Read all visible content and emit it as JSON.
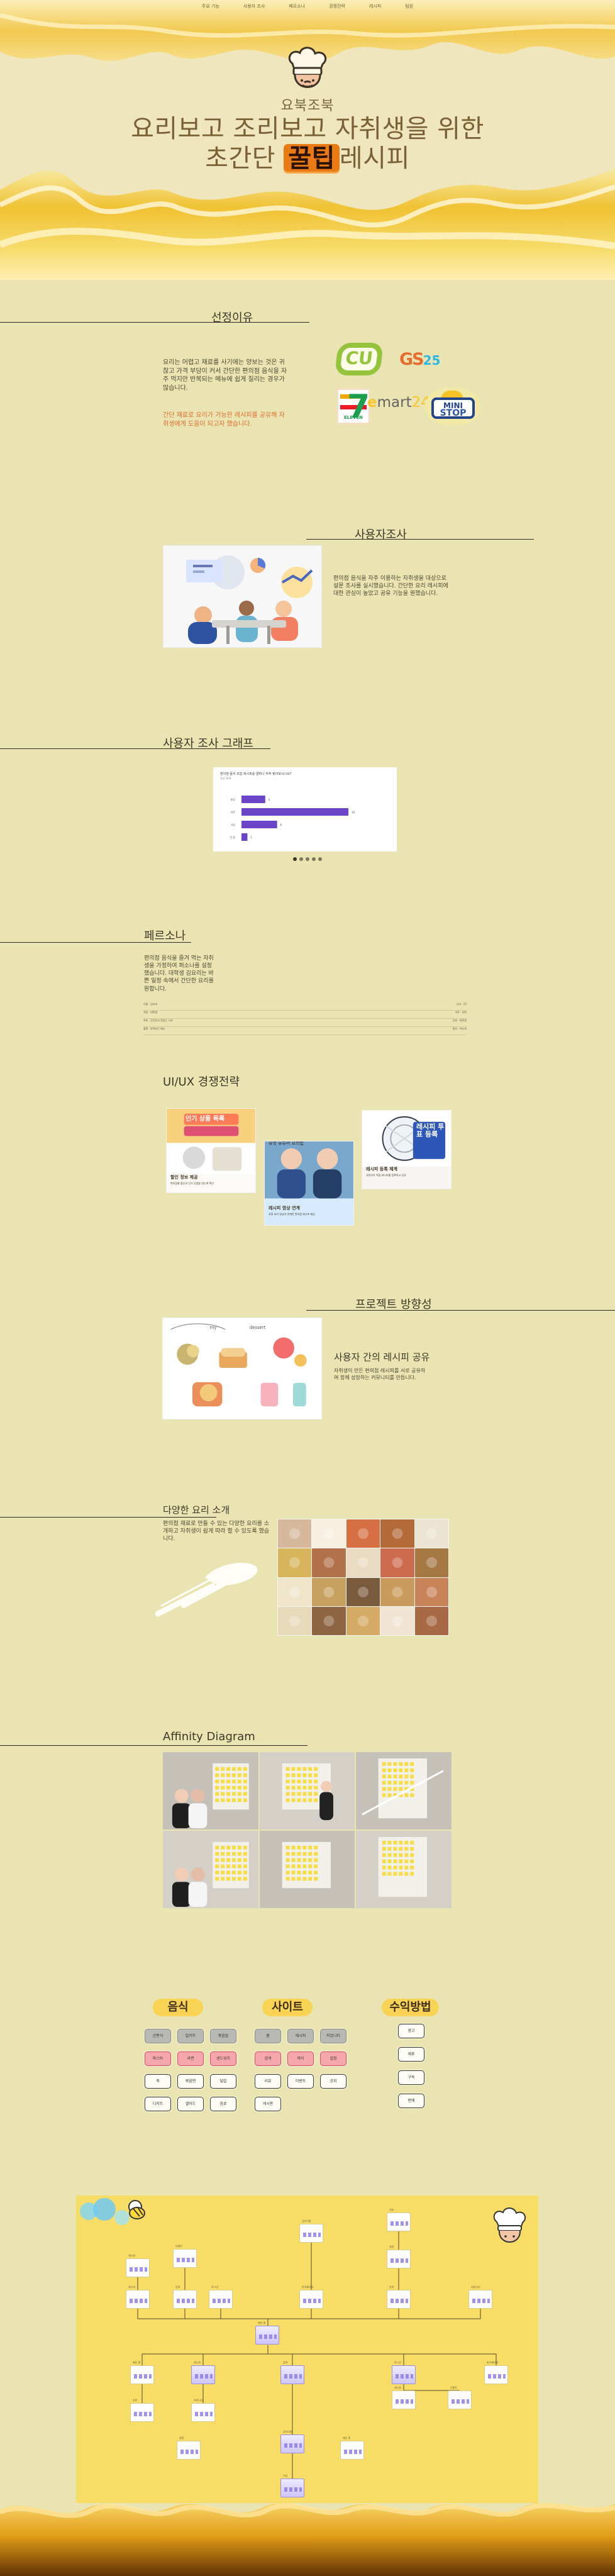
{
  "nav": {
    "items": [
      "주요 기능",
      "사용자 조사",
      "페르소나",
      "경쟁전략",
      "레시피",
      "팀원"
    ]
  },
  "hero": {
    "subtitle": "요북조북",
    "line1": "요리보고 조리보고 자취생을 위한",
    "line2_prefix": "초간단 ",
    "line2_tag": "꿀팁",
    "line2_suffix": "레시피"
  },
  "reason": {
    "title": "선정이유",
    "body": "요리는 어렵고 재료를 사기에는 양보는 것은 귀찮고 가격 부담이 커서 간단한 편의점 음식을 자주 먹지만 반복되는 메뉴에 쉽게 질리는 경우가 많습니다.",
    "note": "간단 재료로 요리가 가능한 레시피를 공유해 자취생에게 도움이 되고자 했습니다."
  },
  "survey": {
    "title": "사용자조사",
    "body": "편의점 음식을 자주 이용하는 자취생을 대상으로 설문 조사를 실시했습니다. 간단한 요리 레시피에 대한 관심이 높았고 공유 기능을 원했습니다."
  },
  "graph": {
    "title": "사용자 조사 그래프",
    "caption": "편의점 음식 조합 레시피를 얼마나 자주 찾아보시나요?",
    "caption2": "응답 29개",
    "bars": [
      {
        "label": "항상",
        "value": 4
      },
      {
        "label": "자주",
        "value": 18
      },
      {
        "label": "가끔",
        "value": 6
      },
      {
        "label": "안 함",
        "value": 1
      }
    ]
  },
  "persona": {
    "title": "페르소나",
    "body": "편의점 음식을 즐겨 먹는 자취생을 가정하여 퍼소나를 설정했습니다. 대학생 김요리는 바쁜 일정 속에서 간단한 요리를 원합니다.",
    "rows": [
      {
        "left": "이름 · 김요리",
        "right": "나이 · 23"
      },
      {
        "left": "직업 · 대학생",
        "right": "거주 · 자취"
      },
      {
        "left": "목표 · 간단하고 맛있는 식사",
        "right": "선호 · 편의점"
      },
      {
        "left": "불편 · 반복되는 메뉴",
        "right": "필요 · 레시피"
      }
    ]
  },
  "strategy": {
    "title": "UI/UX 경쟁전략",
    "cards": [
      {
        "heading": "인기 상품 목록",
        "title": "할인 정보 제공",
        "desc": "편의점별 할인과 인기 상품을 한눈에 확인"
      },
      {
        "heading": "유명 유튜버 요리법",
        "title": "레시피 영상 연계",
        "desc": "유명 요리 영상과 연계한 편의점 레시피 제공"
      },
      {
        "heading": "레시피 투표 등록",
        "title": "레시피 등록 체계",
        "desc": "사용자가 직접 레시피를 등록하고 공유"
      }
    ]
  },
  "direction": {
    "title": "프로젝트 방향성",
    "subtitle": "사용자 간의 레시피 공유",
    "body": "자취생이 만든 편의점 레시피를 서로 공유하며 함께 성장하는 커뮤니티를 만듭니다."
  },
  "dishes": {
    "title": "다양한 요리 소개",
    "body": "편의점 재료로 만들 수 있는 다양한 요리를 소개하고 자취생이 쉽게 따라 할 수 있도록 했습니다."
  },
  "affinity": {
    "title": "Affinity Diagram"
  },
  "categories": {
    "food": {
      "title": "음식",
      "items": [
        "간편식",
        "밀키트",
        "볶음밥",
        "파스타",
        "라면",
        "샌드위치",
        "죽",
        "볶음면",
        "덮밥",
        "디저트",
        "샐러드",
        "음료"
      ]
    },
    "site": {
      "title": "사이트",
      "items": [
        "홈",
        "레시피",
        "커뮤니티",
        "검색",
        "마이",
        "설정",
        "리뷰",
        "이벤트",
        "공지",
        "게시판"
      ]
    },
    "revenue": {
      "title": "수익방법",
      "items": [
        "광고",
        "제휴",
        "구독",
        "판매"
      ]
    }
  },
  "sitemap": {
    "labels": [
      "메인 홈",
      "레시피",
      "검색",
      "로그인",
      "마이페이지",
      "추천",
      "커뮤니티",
      "게시판",
      "이벤트",
      "공지사항",
      "리뷰",
      "설정"
    ]
  },
  "colors": {
    "background": "#e9e4b1",
    "honey": "#f6c94f",
    "orange": "#ea7a13",
    "text": "#403623",
    "purple": "#6a45c8"
  }
}
